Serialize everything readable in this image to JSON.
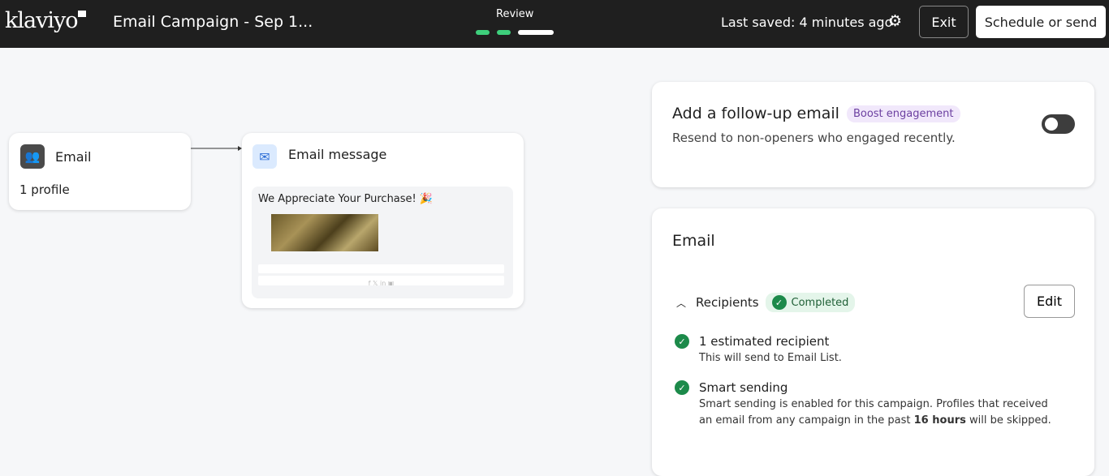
{
  "header": {
    "logo": "klaviyo",
    "title": "Email Campaign - Sep 1...",
    "step_label": "Review",
    "saved": "Last saved: 4 minutes ago",
    "exit": "Exit",
    "schedule": "Schedule or send"
  },
  "flow": {
    "audience_title": "Email",
    "audience_count": "1 profile",
    "message_title": "Email message",
    "preview_subject": "We Appreciate Your Purchase! 🎉",
    "social": "f  𝕏  in  ▣"
  },
  "followup": {
    "title": "Add a follow-up email",
    "badge": "Boost engagement",
    "desc": "Resend to non-openers who engaged recently.",
    "enabled": false
  },
  "email": {
    "title": "Email",
    "recipients_label": "Recipients",
    "status": "Completed",
    "edit": "Edit",
    "items": [
      {
        "title": "1 estimated recipient",
        "desc": "This will send to Email List."
      },
      {
        "title": "Smart sending",
        "desc_pre": "Smart sending is enabled for this campaign. Profiles that received an email from any campaign in the past ",
        "desc_bold": "16 hours",
        "desc_post": " will be skipped."
      }
    ]
  },
  "colors": {
    "accent_green": "#3ecf7c",
    "badge_purple": "#f1e8fb"
  }
}
